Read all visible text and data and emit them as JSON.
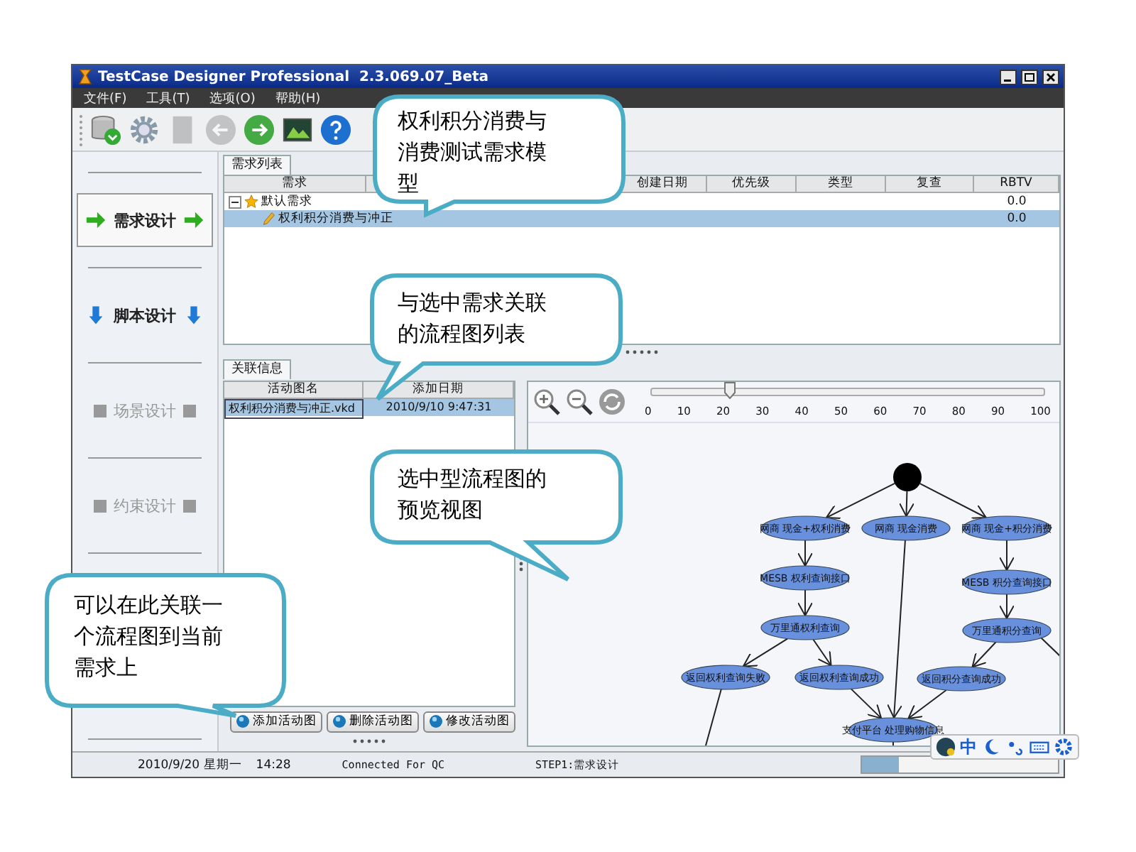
{
  "window": {
    "title": "TestCase Designer Professional  2.3.069.07_Beta"
  },
  "menu": [
    "文件(F)",
    "工具(T)",
    "选项(O)",
    "帮助(H)"
  ],
  "toolbar": [
    {
      "kind": "database",
      "disabled": false
    },
    {
      "kind": "gear",
      "disabled": false
    },
    {
      "kind": "document",
      "disabled": true
    },
    {
      "kind": "back",
      "disabled": true
    },
    {
      "kind": "forward",
      "disabled": false
    },
    {
      "kind": "image",
      "disabled": false
    },
    {
      "kind": "help",
      "disabled": false
    }
  ],
  "nav": {
    "items": [
      {
        "label": "需求设计",
        "kind": "arrow-right",
        "selected": true,
        "disabled": false
      },
      {
        "label": "脚本设计",
        "kind": "arrow-down",
        "selected": false,
        "disabled": false
      },
      {
        "label": "场景设计",
        "kind": "square",
        "selected": false,
        "disabled": true
      },
      {
        "label": "约束设计",
        "kind": "square",
        "selected": false,
        "disabled": true
      }
    ]
  },
  "requirements": {
    "tab": "需求列表",
    "columns": [
      "需求",
      "创建日期",
      "优先级",
      "类型",
      "复查",
      "RBTV"
    ],
    "rows": [
      {
        "label": "默认需求",
        "rbtv": "0.0",
        "selected": false,
        "expanded": true,
        "children": [
          {
            "label": "权利积分消费与冲正",
            "rbtv": "0.0",
            "selected": true
          }
        ]
      }
    ]
  },
  "related": {
    "tab": "关联信息",
    "columns": [
      "活动图名",
      "添加日期"
    ],
    "rows": [
      {
        "name": "权利积分消费与冲正.vkd",
        "date": "2010/9/10 9:47:31",
        "selected": true
      }
    ],
    "buttons": [
      "添加活动图",
      "删除活动图",
      "修改活动图"
    ]
  },
  "preview": {
    "zoom": {
      "level": 0.2,
      "ticks": [
        "0",
        "10",
        "20",
        "30",
        "40",
        "50",
        "60",
        "70",
        "80",
        "90",
        "100"
      ]
    },
    "nodes": [
      "网商 现金+权利消费",
      "网商 现金消费",
      "网商 现金+积分消费",
      "MESB 权利查询接口",
      "MESB 积分查询接口",
      "万里通权利查询",
      "万里通积分查询",
      "返回权利查询失败",
      "返回权利查询成功",
      "返回积分查询成功",
      "支付平台 处理购物信息"
    ]
  },
  "status_bar": {
    "date": "2010/9/20 星期一",
    "time": "14:28",
    "connection": "Connected For QC",
    "step": "STEP1:需求设计",
    "progress": {
      "level": 0.19
    }
  },
  "ime": {
    "mode": "中"
  },
  "callouts": [
    "权利积分消费与消费测试需求模型",
    "与选中需求关联的流程图列表",
    "选中型流程图的预览视图",
    "可以在此关联一个流程图到当前需求上"
  ]
}
